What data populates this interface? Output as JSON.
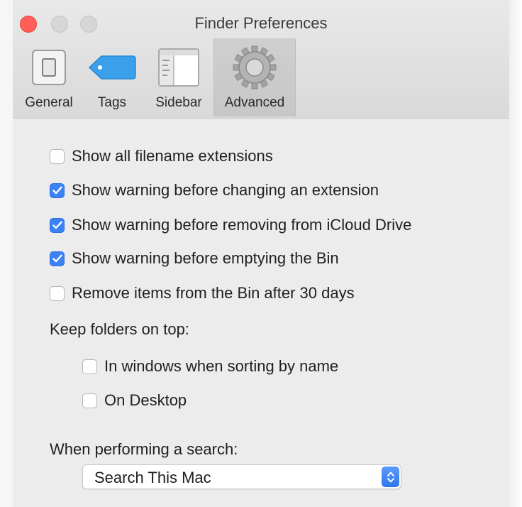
{
  "window": {
    "title": "Finder Preferences"
  },
  "tabs": [
    {
      "label": "General",
      "icon": "general-switch-icon",
      "active": false
    },
    {
      "label": "Tags",
      "icon": "tag-icon",
      "active": false
    },
    {
      "label": "Sidebar",
      "icon": "sidebar-icon",
      "active": false
    },
    {
      "label": "Advanced",
      "icon": "gear-icon",
      "active": true
    }
  ],
  "options": [
    {
      "label": "Show all filename extensions",
      "checked": false
    },
    {
      "label": "Show warning before changing an extension",
      "checked": true
    },
    {
      "label": "Show warning before removing from iCloud Drive",
      "checked": true
    },
    {
      "label": "Show warning before emptying the Bin",
      "checked": true
    },
    {
      "label": "Remove items from the Bin after 30 days",
      "checked": false
    }
  ],
  "keep_folders": {
    "label": "Keep folders on top:",
    "options": [
      {
        "label": "In windows when sorting by name",
        "checked": false
      },
      {
        "label": "On Desktop",
        "checked": false
      }
    ]
  },
  "search": {
    "label": "When performing a search:",
    "selected": "Search This Mac"
  },
  "colors": {
    "accent": "#3b82f6",
    "close": "#ff5f57"
  }
}
